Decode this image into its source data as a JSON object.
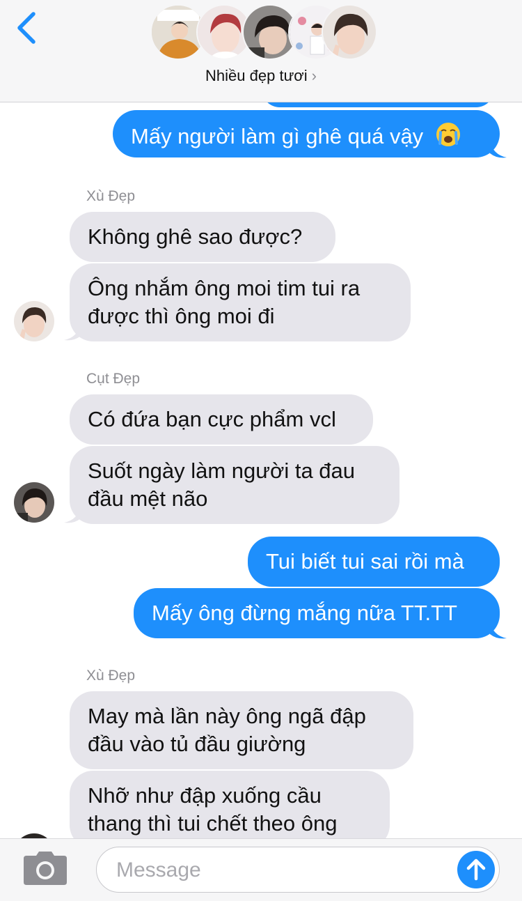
{
  "header": {
    "back_icon": "chevron-left-icon",
    "group_name": "Nhiều đẹp tươi",
    "group_chevron": "›",
    "accent": "#1e8ffc"
  },
  "messages": {
    "m0": "Mấy người làm gì ghê quá vậy",
    "m0_emoji": "😭",
    "sender1": "Xù Đẹp",
    "m1": "Không ghê sao được?",
    "m2_l1": "Ông nhắm ông moi tim tui ra",
    "m2_l2": "được thì ông moi đi",
    "sender2": "Cụt Đẹp",
    "m3": "Có đứa bạn cực phẩm vcl",
    "m4_l1": "Suốt ngày làm người ta đau",
    "m4_l2": "đầu mệt não",
    "m5": "Tui biết tui sai rồi mà",
    "m6": "Mấy ông đừng mắng nữa TT.TT",
    "sender3": "Xù Đẹp",
    "m7_l1": "May mà lần này ông ngã đập",
    "m7_l2": "đầu vào tủ đầu giường",
    "m8_l1": "Nhỡ như đập xuống cầu",
    "m8_l2": "thang thì tui chết theo ông"
  },
  "input": {
    "placeholder": "Message",
    "camera_icon": "camera-icon",
    "send_icon": "arrow-up-icon"
  },
  "colors": {
    "incoming_bubble": "#e6e5eb",
    "outgoing_bubble": "#1e8ffc",
    "sender_name": "#8e8e93"
  }
}
